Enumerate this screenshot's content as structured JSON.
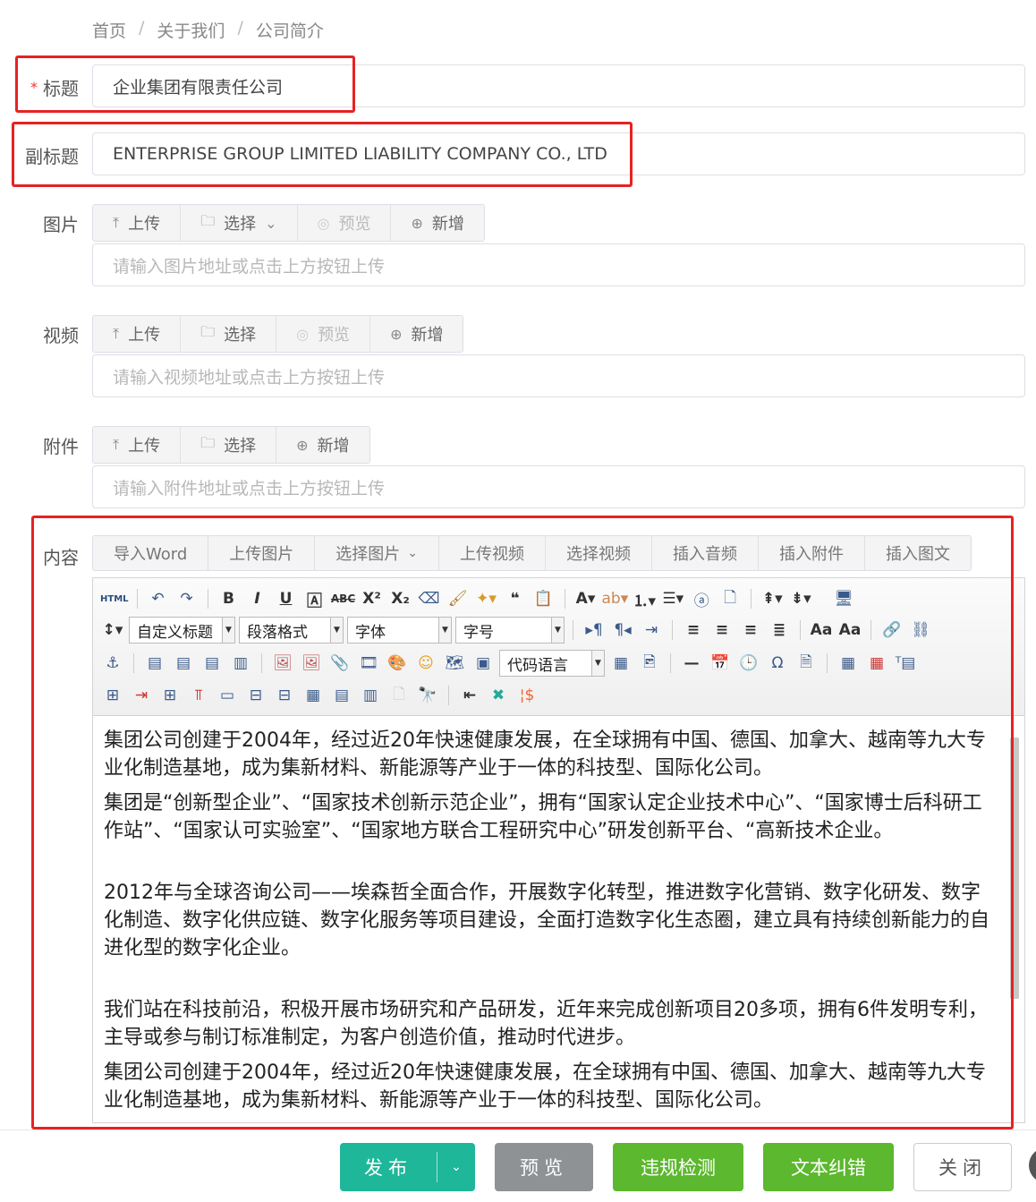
{
  "breadcrumb": {
    "home": "首页",
    "about": "关于我们",
    "current": "公司简介",
    "sep": "/"
  },
  "form": {
    "title": {
      "label": "标题",
      "required_mark": "*",
      "value": "企业集团有限责任公司"
    },
    "subtitle": {
      "label": "副标题",
      "value": "ENTERPRISE GROUP LIMITED LIABILITY COMPANY CO., LTD"
    },
    "image": {
      "label": "图片",
      "upload": "上传",
      "select": "选择",
      "preview": "预览",
      "add": "新增",
      "placeholder": "请输入图片地址或点击上方按钮上传"
    },
    "video": {
      "label": "视频",
      "upload": "上传",
      "select": "选择",
      "preview": "预览",
      "add": "新增",
      "placeholder": "请输入视频地址或点击上方按钮上传"
    },
    "attachment": {
      "label": "附件",
      "upload": "上传",
      "select": "选择",
      "add": "新增",
      "placeholder": "请输入附件地址或点击上方按钮上传"
    },
    "content": {
      "label": "内容",
      "tabs": [
        "导入Word",
        "上传图片",
        "选择图片",
        "上传视频",
        "选择视频",
        "插入音频",
        "插入附件",
        "插入图文"
      ]
    }
  },
  "editor": {
    "html_label": "HTML",
    "custom_title": "自定义标题",
    "paragraph_format": "段落格式",
    "font": "字体",
    "font_size": "字号",
    "code_lang": "代码语言",
    "paragraphs": [
      "集团公司创建于2004年，经过近20年快速健康发展，在全球拥有中国、德国、加拿大、越南等九大专业化制造基地，成为集新材料、新能源等产业于一体的科技型、国际化公司。",
      "集团是“创新型企业”、“国家技术创新示范企业”，拥有“国家认定企业技术中心”、“国家博士后科研工作站”、“国家认可实验室”、“国家地方联合工程研究中心”研发创新平台、“高新技术企业。",
      "2012年与全球咨询公司——埃森哲全面合作，开展数字化转型，推进数字化营销、数字化研发、数字化制造、数字化供应链、数字化服务等项目建设，全面打造数字化生态圈，建立具有持续创新能力的自进化型的数字化企业。",
      "我们站在科技前沿，积极开展市场研究和产品研发，近年来完成创新项目20多项，拥有6件发明专利，主导或参与制订标准制定，为客户创造价值，推动时代进步。",
      "集团公司创建于2004年，经过近20年快速健康发展，在全球拥有中国、德国、加拿大、越南等九大专业化制造基地，成为集新材料、新能源等产业于一体的科技型、国际化公司。"
    ]
  },
  "footer": {
    "publish": "发布",
    "preview": "预览",
    "check": "违规检测",
    "correct": "文本纠错",
    "close": "关闭"
  },
  "colors": {
    "highlight_border": "#e62222",
    "publish": "#1fb79a",
    "green": "#5cb82e",
    "gray": "#8f9295"
  }
}
